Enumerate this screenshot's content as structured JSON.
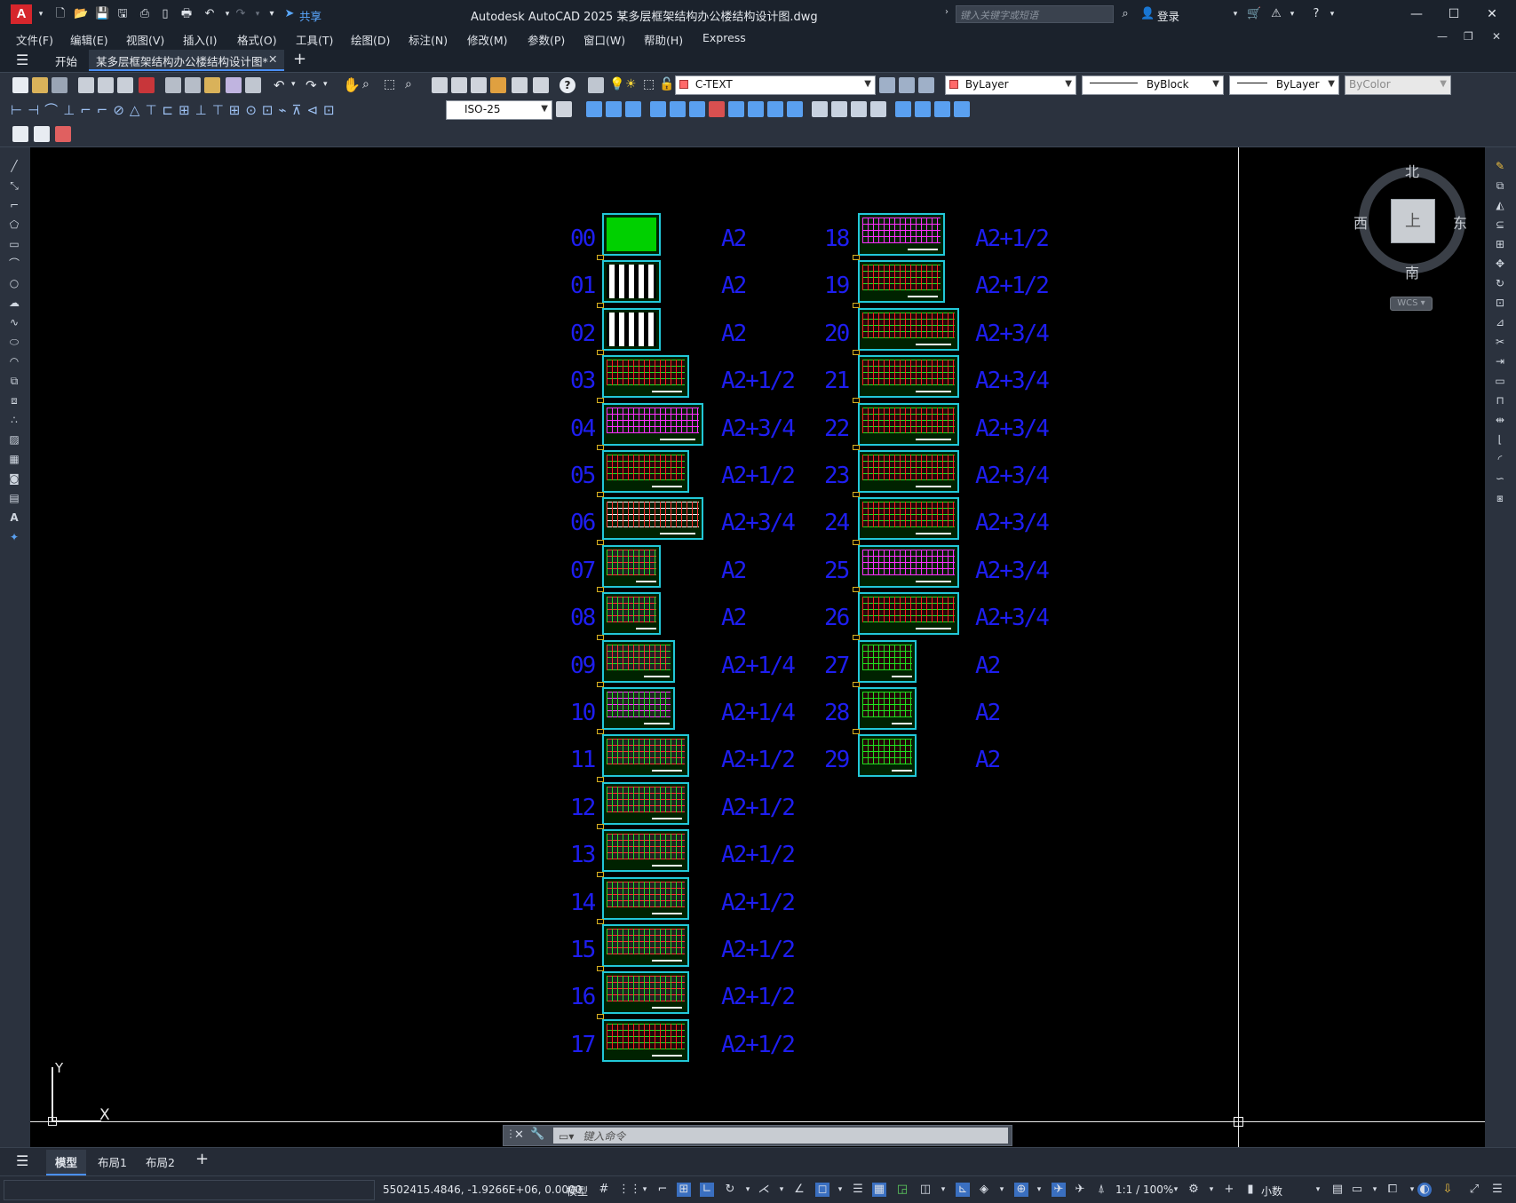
{
  "app": {
    "logo": "A",
    "title": "Autodesk AutoCAD 2025    某多层框架结构办公楼结构设计图.dwg",
    "share_label": "共享",
    "search_placeholder": "键入关键字或短语",
    "login_label": "登录"
  },
  "menu": [
    "文件(F)",
    "编辑(E)",
    "视图(V)",
    "插入(I)",
    "格式(O)",
    "工具(T)",
    "绘图(D)",
    "标注(N)",
    "修改(M)",
    "参数(P)",
    "窗口(W)",
    "帮助(H)",
    "Express"
  ],
  "tabs": {
    "start": "开始",
    "file": "某多层框架结构办公楼结构设计图*"
  },
  "toolbar": {
    "layer": "C-TEXT",
    "color": "ByLayer",
    "linetype": "ByBlock",
    "lineweight": "ByLayer",
    "plotstyle": "ByColor",
    "dimstyle": "ISO-25",
    "accent_layer_color": "#ff6060"
  },
  "viewcube": {
    "north": "北",
    "south": "南",
    "east": "东",
    "west": "西",
    "top": "上",
    "wcs": "WCS"
  },
  "ucs": {
    "x": "X",
    "y": "Y"
  },
  "drawing": {
    "left_column": [
      {
        "no": "00",
        "size": "A2",
        "kind": "cover"
      },
      {
        "no": "01",
        "size": "A2",
        "kind": "notes"
      },
      {
        "no": "02",
        "size": "A2",
        "kind": "notes"
      },
      {
        "no": "03",
        "size": "A2+1/2",
        "kind": "plan-red"
      },
      {
        "no": "04",
        "size": "A2+3/4",
        "kind": "plan-magenta"
      },
      {
        "no": "05",
        "size": "A2+1/2",
        "kind": "plan-red"
      },
      {
        "no": "06",
        "size": "A2+3/4",
        "kind": "plan-mixed"
      },
      {
        "no": "07",
        "size": "A2",
        "kind": "detail"
      },
      {
        "no": "08",
        "size": "A2",
        "kind": "detail"
      },
      {
        "no": "09",
        "size": "A2+1/4",
        "kind": "detail-red"
      },
      {
        "no": "10",
        "size": "A2+1/4",
        "kind": "detail-mix"
      },
      {
        "no": "11",
        "size": "A2+1/2",
        "kind": "plan-green"
      },
      {
        "no": "12",
        "size": "A2+1/2",
        "kind": "plan-green"
      },
      {
        "no": "13",
        "size": "A2+1/2",
        "kind": "plan-green"
      },
      {
        "no": "14",
        "size": "A2+1/2",
        "kind": "plan-green"
      },
      {
        "no": "15",
        "size": "A2+1/2",
        "kind": "plan-green"
      },
      {
        "no": "16",
        "size": "A2+1/2",
        "kind": "plan-green"
      },
      {
        "no": "17",
        "size": "A2+1/2",
        "kind": "plan-red"
      }
    ],
    "right_column": [
      {
        "no": "18",
        "size": "A2+1/2",
        "kind": "plan-magenta"
      },
      {
        "no": "19",
        "size": "A2+1/2",
        "kind": "plan-red"
      },
      {
        "no": "20",
        "size": "A2+3/4",
        "kind": "plan-red"
      },
      {
        "no": "21",
        "size": "A2+3/4",
        "kind": "plan-red"
      },
      {
        "no": "22",
        "size": "A2+3/4",
        "kind": "plan-red"
      },
      {
        "no": "23",
        "size": "A2+3/4",
        "kind": "plan-red"
      },
      {
        "no": "24",
        "size": "A2+3/4",
        "kind": "plan-red"
      },
      {
        "no": "25",
        "size": "A2+3/4",
        "kind": "plan-magenta"
      },
      {
        "no": "26",
        "size": "A2+3/4",
        "kind": "plan-red"
      },
      {
        "no": "27",
        "size": "A2",
        "kind": "detail-green"
      },
      {
        "no": "28",
        "size": "A2",
        "kind": "detail-green"
      },
      {
        "no": "29",
        "size": "A2",
        "kind": "detail-green"
      }
    ]
  },
  "command": {
    "placeholder": "键入命令"
  },
  "layout_tabs": [
    "模型",
    "布局1",
    "布局2"
  ],
  "status": {
    "coords": "5502415.4846, -1.9266E+06, 0.0000",
    "model": "模型",
    "scale": "1:1 / 100%",
    "units": "小数"
  }
}
